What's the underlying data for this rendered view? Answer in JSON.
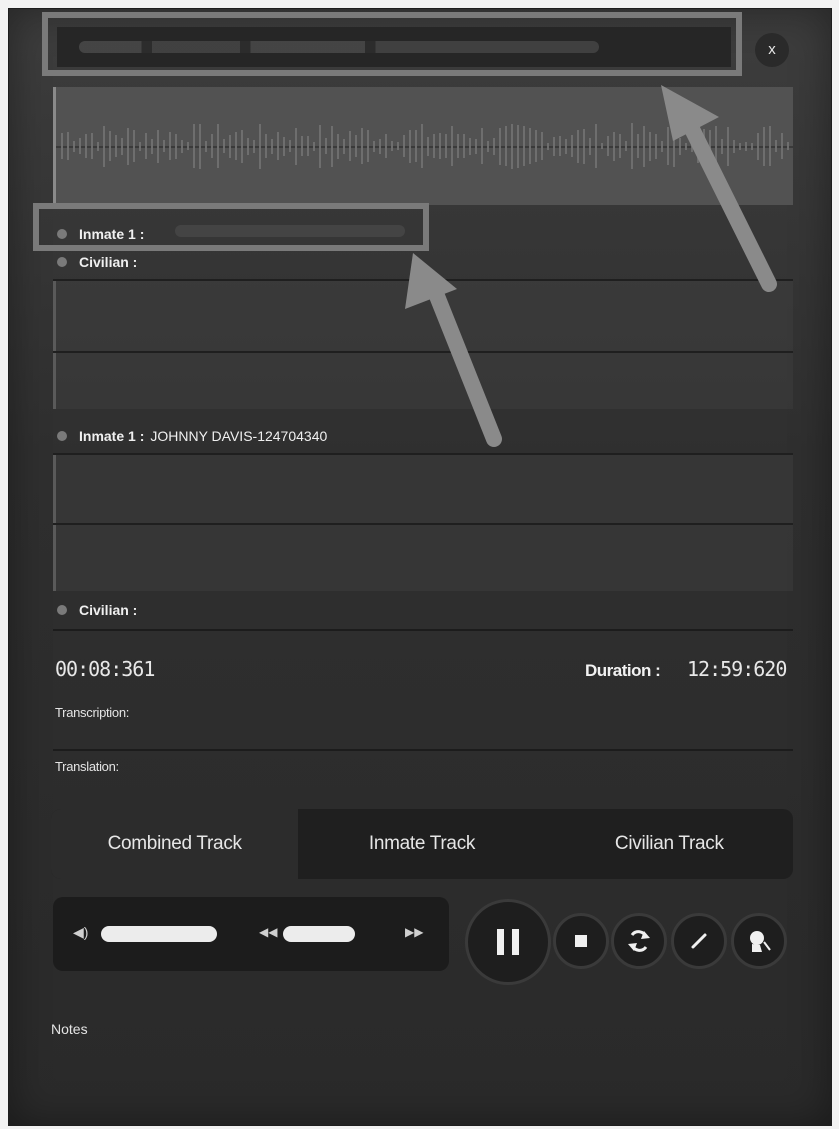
{
  "window": {
    "close_label": "x"
  },
  "speakers": [
    {
      "role": "Inmate 1 :",
      "name": ""
    },
    {
      "role": "Civilian :",
      "name": ""
    },
    {
      "role": "Inmate 1 :",
      "name": "JOHNNY DAVIS-124704340"
    },
    {
      "role": "Civilian :",
      "name": ""
    }
  ],
  "playback": {
    "current_time": "00:08:361",
    "duration_label": "Duration :",
    "duration_value": "12:59:620"
  },
  "fields": {
    "transcription_label": "Transcription:",
    "translation_label": "Translation:",
    "notes_label": "Notes"
  },
  "tracks": {
    "tabs": [
      "Combined Track",
      "Inmate Track",
      "Civilian Track"
    ],
    "active": "Combined Track"
  },
  "controls": {
    "volume_icon": "volume-icon",
    "rewind_icon": "rewind-icon",
    "forward_icon": "forward-icon",
    "pause_icon": "pause-icon",
    "stop_icon": "stop-icon",
    "loop_icon": "loop-icon",
    "edit_icon": "pencil-icon",
    "speaker_icon": "speaker-profile-icon"
  },
  "colors": {
    "panel": "#333333",
    "highlight": "#7a7a7a",
    "text": "#f0f0f0"
  }
}
